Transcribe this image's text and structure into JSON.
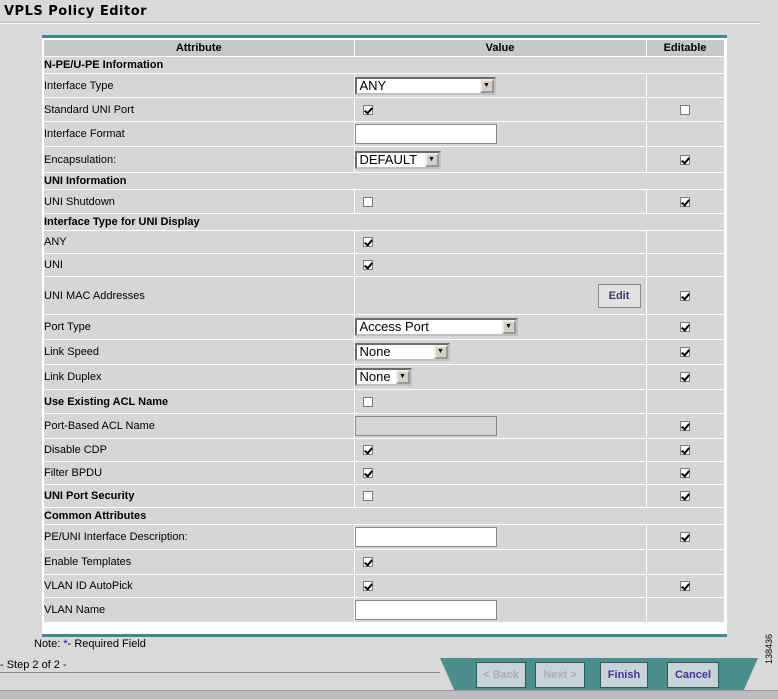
{
  "title": "VPLS Policy Editor",
  "columns": {
    "attribute": "Attribute",
    "value": "Value",
    "editable": "Editable"
  },
  "rows": [
    {
      "type": "section",
      "label": "N-PE/U-PE Information"
    },
    {
      "type": "field",
      "label": "Interface Type",
      "control": "select",
      "value": "ANY",
      "width": 141,
      "editable": null
    },
    {
      "type": "field",
      "label": "Standard UNI Port",
      "control": "checkbox",
      "checked": true,
      "editable": false
    },
    {
      "type": "field",
      "label": "Interface Format",
      "control": "input",
      "value": "",
      "width": 142,
      "editable": null
    },
    {
      "type": "field",
      "label": "Encapsulation:",
      "control": "select",
      "value": "DEFAULT",
      "width": 86,
      "editable": true
    },
    {
      "type": "section",
      "label": "UNI Information"
    },
    {
      "type": "field",
      "label": "UNI Shutdown",
      "control": "checkbox",
      "checked": false,
      "editable": true
    },
    {
      "type": "section",
      "label": "Interface Type for UNI Display"
    },
    {
      "type": "field",
      "label": "ANY",
      "control": "checkbox",
      "checked": true,
      "editable": null
    },
    {
      "type": "field",
      "label": "UNI",
      "control": "checkbox",
      "checked": true,
      "editable": null
    },
    {
      "type": "field",
      "label": "UNI MAC Addresses",
      "control": "button",
      "value": "Edit",
      "editable": true,
      "tall": true
    },
    {
      "type": "field",
      "label": "Port Type",
      "control": "select",
      "value": "Access Port",
      "width": 163,
      "editable": true
    },
    {
      "type": "field",
      "label": "Link Speed",
      "control": "select",
      "value": "None",
      "width": 95,
      "editable": true
    },
    {
      "type": "field",
      "label": "Link Duplex",
      "control": "select",
      "value": "None",
      "width": 57,
      "editable": true
    },
    {
      "type": "section-field",
      "label": "Use Existing ACL Name",
      "control": "checkbox",
      "checked": false,
      "editable": null
    },
    {
      "type": "field",
      "label": "Port-Based ACL Name",
      "control": "input-disabled",
      "value": "",
      "width": 142,
      "editable": true
    },
    {
      "type": "field",
      "label": "Disable CDP",
      "control": "checkbox",
      "checked": true,
      "editable": true
    },
    {
      "type": "field",
      "label": "Filter BPDU",
      "control": "checkbox",
      "checked": true,
      "editable": true
    },
    {
      "type": "field",
      "label": "UNI Port Security",
      "control": "checkbox",
      "checked": false,
      "editable": true,
      "bold": true
    },
    {
      "type": "section",
      "label": "Common Attributes"
    },
    {
      "type": "field",
      "label": "PE/UNI Interface Description:",
      "control": "input",
      "value": "",
      "width": 142,
      "editable": true
    },
    {
      "type": "field",
      "label": "Enable Templates",
      "control": "checkbox",
      "checked": true,
      "editable": null
    },
    {
      "type": "field",
      "label": "VLAN ID AutoPick",
      "control": "checkbox",
      "checked": true,
      "editable": true
    },
    {
      "type": "field",
      "label": "VLAN Name",
      "control": "input",
      "value": "",
      "width": 142,
      "editable": null
    }
  ],
  "note": {
    "prefix": "Note: ",
    "star": "*",
    "suffix": "- Required Field"
  },
  "step": "- Step 2 of 2 -",
  "buttons": {
    "back": "< Back",
    "next": "Next >",
    "finish": "Finish",
    "cancel": "Cancel"
  },
  "figure_id": "138436"
}
